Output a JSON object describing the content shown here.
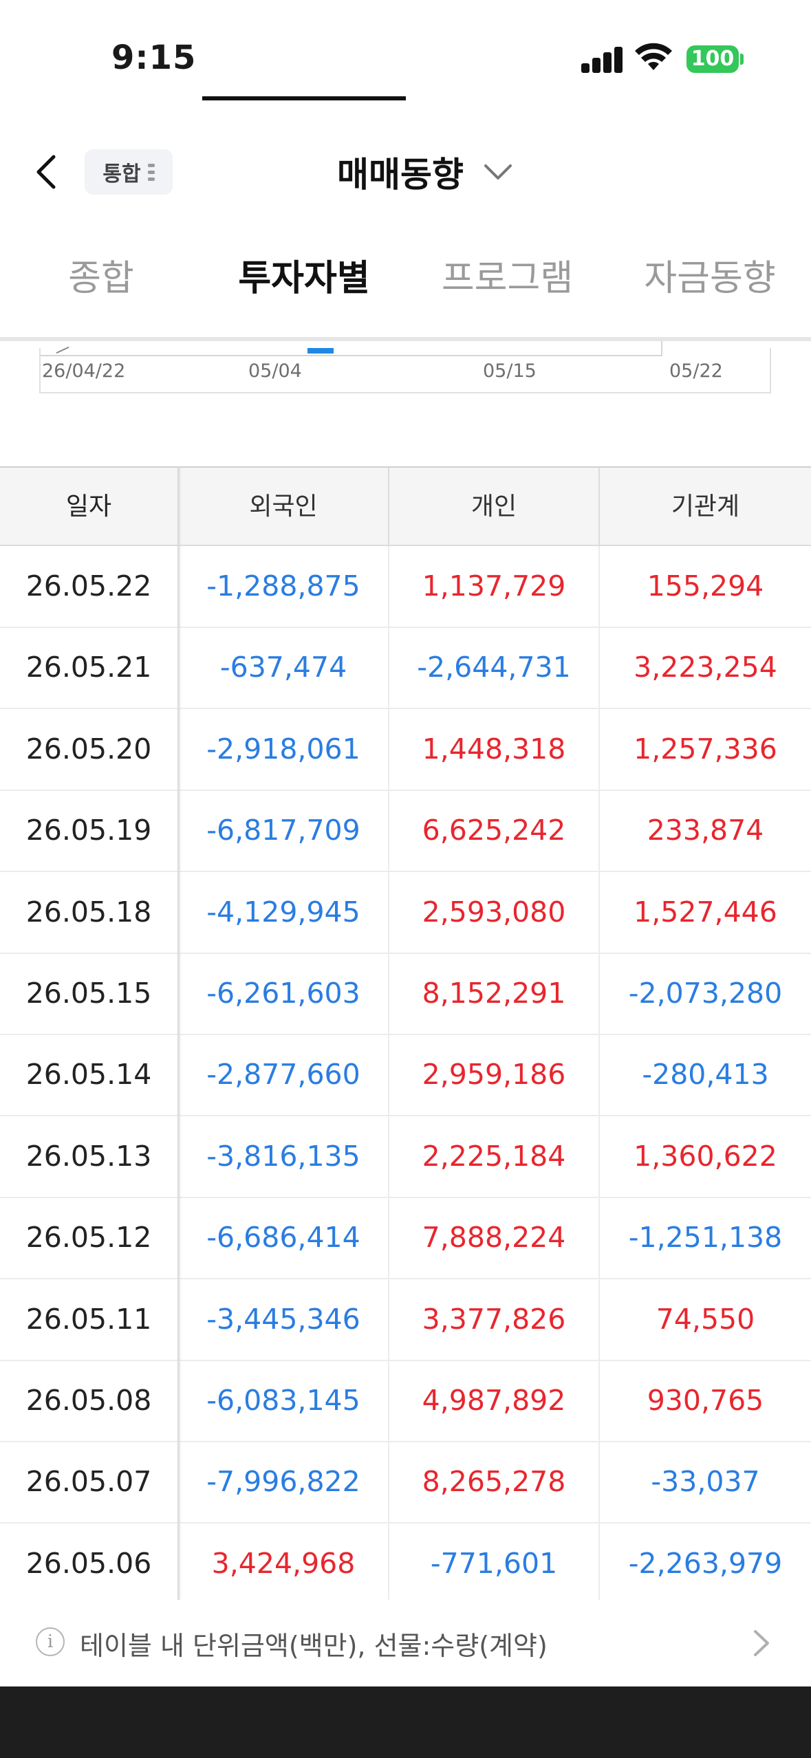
{
  "status_bar": {
    "time": "9:15",
    "battery": "100"
  },
  "header": {
    "scope_label": "통합",
    "title": "매매동향"
  },
  "tabs": [
    {
      "label": "종합",
      "active": false
    },
    {
      "label": "투자자별",
      "active": true
    },
    {
      "label": "프로그램",
      "active": false
    },
    {
      "label": "자금동향",
      "active": false
    }
  ],
  "chart_axis": {
    "ticks": [
      "26/04/22",
      "05/04",
      "05/15",
      "05/22"
    ]
  },
  "table": {
    "headers": [
      "일자",
      "외국인",
      "개인",
      "기관계"
    ],
    "rows": [
      [
        "26.05.22",
        "-1,288,875",
        "1,137,729",
        "155,294"
      ],
      [
        "26.05.21",
        "-637,474",
        "-2,644,731",
        "3,223,254"
      ],
      [
        "26.05.20",
        "-2,918,061",
        "1,448,318",
        "1,257,336"
      ],
      [
        "26.05.19",
        "-6,817,709",
        "6,625,242",
        "233,874"
      ],
      [
        "26.05.18",
        "-4,129,945",
        "2,593,080",
        "1,527,446"
      ],
      [
        "26.05.15",
        "-6,261,603",
        "8,152,291",
        "-2,073,280"
      ],
      [
        "26.05.14",
        "-2,877,660",
        "2,959,186",
        "-280,413"
      ],
      [
        "26.05.13",
        "-3,816,135",
        "2,225,184",
        "1,360,622"
      ],
      [
        "26.05.12",
        "-6,686,414",
        "7,888,224",
        "-1,251,138"
      ],
      [
        "26.05.11",
        "-3,445,346",
        "3,377,826",
        "74,550"
      ],
      [
        "26.05.08",
        "-6,083,145",
        "4,987,892",
        "930,765"
      ],
      [
        "26.05.07",
        "-7,996,822",
        "8,265,278",
        "-33,037"
      ],
      [
        "26.05.06",
        "3,424,968",
        "-771,601",
        "-2,263,979"
      ]
    ]
  },
  "footer_note": {
    "text": "테이블 내 단위금액(백만), 선물:수량(계약)"
  },
  "colors": {
    "positive": "#e8262e",
    "negative": "#2a7de1",
    "active_tab": "#111111",
    "chart_marker": "#1e88e5"
  },
  "icons": [
    "back-chevron-icon",
    "menu-dots-icon",
    "dropdown-chevron-icon",
    "info-icon",
    "chevron-right-icon",
    "signal-icon",
    "wifi-icon",
    "battery-icon"
  ]
}
